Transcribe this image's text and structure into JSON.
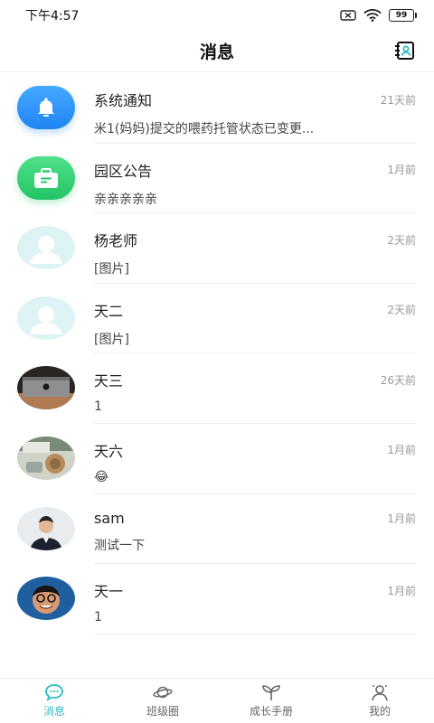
{
  "status_bar": {
    "time": "下午4:57",
    "battery": "99"
  },
  "header": {
    "title": "消息"
  },
  "messages": [
    {
      "name": "系统通知",
      "time": "21天前",
      "preview": "米1(妈妈)提交的喂药托管状态已变更...",
      "avatar": "bell-icon"
    },
    {
      "name": "园区公告",
      "time": "1月前",
      "preview": "亲亲亲亲亲",
      "avatar": "briefcase-icon"
    },
    {
      "name": "杨老师",
      "time": "2天前",
      "preview": "[图片]",
      "avatar": "user-placeholder-icon"
    },
    {
      "name": "天二",
      "time": "2天前",
      "preview": "[图片]",
      "avatar": "user-placeholder-icon"
    },
    {
      "name": "天三",
      "time": "26天前",
      "preview": "1",
      "avatar": "photo"
    },
    {
      "name": "天六",
      "time": "1月前",
      "preview": "😂",
      "avatar": "photo"
    },
    {
      "name": "sam",
      "time": "1月前",
      "preview": "测试一下",
      "avatar": "photo"
    },
    {
      "name": "天一",
      "time": "1月前",
      "preview": "1",
      "avatar": "photo"
    }
  ],
  "tabs": [
    {
      "label": "消息",
      "icon": "chat-bubble-icon",
      "active": true
    },
    {
      "label": "班级圈",
      "icon": "planet-icon",
      "active": false
    },
    {
      "label": "成长手册",
      "icon": "sprout-icon",
      "active": false
    },
    {
      "label": "我的",
      "icon": "profile-icon",
      "active": false
    }
  ],
  "colors": {
    "accent": "#2bbcc4",
    "notice_blue": "#1f86f3",
    "announcement_green": "#23c566",
    "placeholder_bg": "#ddf3f4"
  }
}
